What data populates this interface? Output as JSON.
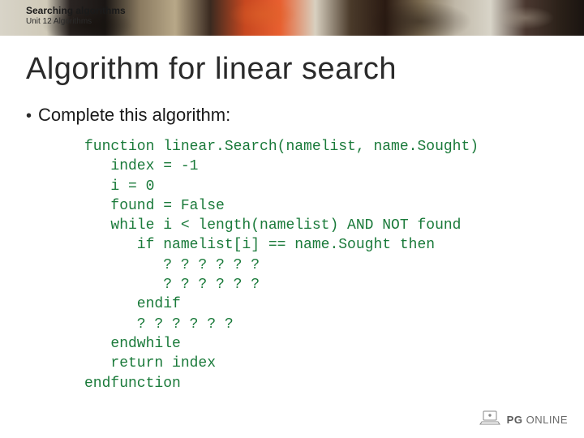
{
  "banner": {
    "title": "Searching algorithms",
    "subtitle": "Unit 12 Algorithms"
  },
  "heading": "Algorithm for linear search",
  "bullet": "Complete this algorithm:",
  "code": "function linear.Search(namelist, name.Sought)\n   index = -1\n   i = 0\n   found = False\n   while i < length(namelist) AND NOT found\n      if namelist[i] == name.Sought then\n         ? ? ? ? ? ?\n         ? ? ? ? ? ?\n      endif\n      ? ? ? ? ? ?\n   endwhile\n   return index\nendfunction",
  "footer": {
    "brand_bold": "PG",
    "brand_light": "ONLINE"
  }
}
